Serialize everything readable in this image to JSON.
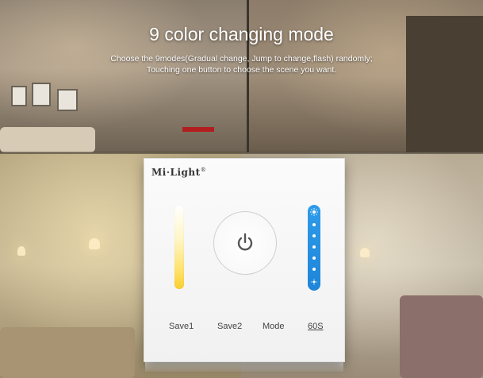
{
  "headline": "9 color changing mode",
  "description": {
    "line1": "Choose the 9modes(Gradual change, Jump to change,flash) randomly;",
    "line2": "Touching one button to choose the scene you want."
  },
  "panel": {
    "brand": "Mi·Light",
    "brand_mark": "®",
    "buttons": {
      "save1": "Save1",
      "save2": "Save2",
      "mode": "Mode",
      "timer": "60S"
    },
    "icons": {
      "power": "power-icon",
      "sun": "sun-icon",
      "brightness": "brightness-dots"
    }
  },
  "colors": {
    "warm_slider": "#f8d02c",
    "blue_slider": "#1e85d8"
  }
}
